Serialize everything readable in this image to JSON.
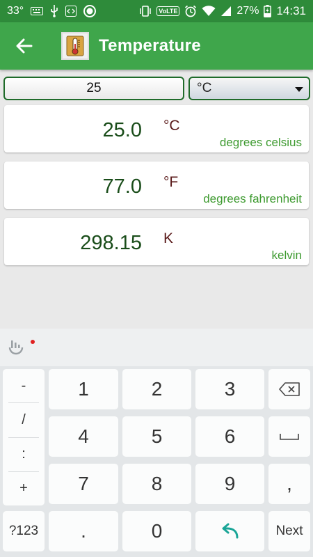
{
  "status": {
    "temp": "33°",
    "battery": "27%",
    "time": "14:31",
    "volte": "VoLTE"
  },
  "appbar": {
    "title": "Temperature",
    "back_icon": "arrow-left-icon",
    "logo_icon": "thermometer-icon"
  },
  "input": {
    "value": "25",
    "unit": "°C"
  },
  "results": [
    {
      "value": "25.0",
      "symbol": "°C",
      "name": "degrees celsius"
    },
    {
      "value": "77.0",
      "symbol": "°F",
      "name": "degrees fahrenheit"
    },
    {
      "value": "298.15",
      "symbol": "K",
      "name": "kelvin"
    }
  ],
  "keyboard": {
    "symbols": [
      "-",
      "/",
      ":",
      "+"
    ],
    "digits": [
      "1",
      "2",
      "3",
      "4",
      "5",
      "6",
      "7",
      "8",
      "9"
    ],
    "comma": ",",
    "mode": "?123",
    "dot": ".",
    "zero": "0",
    "next": "Next"
  },
  "colors": {
    "status_bar": "#2e8b3a",
    "app_bar": "#3fa64b",
    "result_value": "#1a4d1a",
    "unit_name": "#3d9a2f"
  }
}
